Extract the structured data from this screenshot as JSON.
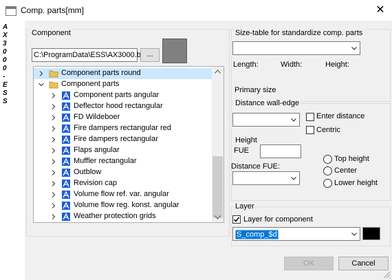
{
  "window": {
    "title": "Comp. parts[mm]",
    "close_symbol": "✕"
  },
  "side": {
    "text": "AX3000 - ESS"
  },
  "component": {
    "group_label": "Component",
    "path_value": "C:\\ProgramData\\ESS\\AX3000.b",
    "browse_label": "...",
    "tree": [
      {
        "label": "Component parts round",
        "icon": "folder-icon",
        "chevron": "right",
        "indent": 0,
        "selected": true
      },
      {
        "label": "Component parts",
        "icon": "folder-icon",
        "chevron": "down",
        "indent": 0,
        "selected": false
      },
      {
        "label": "Component parts angular",
        "icon": "part-icon",
        "chevron": "right",
        "indent": 1,
        "selected": false
      },
      {
        "label": "Deflector hood rectangular",
        "icon": "part-icon",
        "chevron": "right",
        "indent": 1,
        "selected": false
      },
      {
        "label": "FD Wildeboer",
        "icon": "part-icon",
        "chevron": "right",
        "indent": 1,
        "selected": false
      },
      {
        "label": "Fire dampers rectangular red",
        "icon": "part-icon",
        "chevron": "right",
        "indent": 1,
        "selected": false
      },
      {
        "label": "Fire dampers rectangular",
        "icon": "part-icon",
        "chevron": "right",
        "indent": 1,
        "selected": false
      },
      {
        "label": "Flaps angular",
        "icon": "part-icon",
        "chevron": "right",
        "indent": 1,
        "selected": false
      },
      {
        "label": "Muffler rectangular",
        "icon": "part-icon",
        "chevron": "right",
        "indent": 1,
        "selected": false
      },
      {
        "label": "Outblow",
        "icon": "part-icon",
        "chevron": "right",
        "indent": 1,
        "selected": false
      },
      {
        "label": "Revision cap",
        "icon": "part-icon",
        "chevron": "right",
        "indent": 1,
        "selected": false
      },
      {
        "label": "Volume flow ref.  var. angular",
        "icon": "part-icon",
        "chevron": "right",
        "indent": 1,
        "selected": false
      },
      {
        "label": "Volume flow reg. konst. angular",
        "icon": "part-icon",
        "chevron": "right",
        "indent": 1,
        "selected": false
      },
      {
        "label": "Weather protection grids",
        "icon": "part-icon",
        "chevron": "right",
        "indent": 1,
        "selected": false
      }
    ]
  },
  "size_table": {
    "group_label": "Size-table for standardize comp. parts",
    "combo_value": "",
    "length_label": "Length:",
    "width_label": "Width:",
    "height_label": "Height:",
    "primary_size_label": "Primary size"
  },
  "distance": {
    "group_label": "Distance wall-edge",
    "combo_value": "",
    "enter_distance_label": "Enter distance",
    "enter_distance_checked": false,
    "centric_label": "Centric",
    "centric_checked": false
  },
  "height": {
    "group_label": "Height",
    "fue_label": "FUE",
    "fue_value": "",
    "distance_fue_label": "Distance FUE:",
    "distance_fue_value": "",
    "radios": [
      {
        "label": "Top height",
        "checked": false
      },
      {
        "label": "Center",
        "checked": false
      },
      {
        "label": "Lower height",
        "checked": false
      }
    ]
  },
  "layer": {
    "group_label": "Layer",
    "checkbox_label": "Layer for component",
    "checked": true,
    "combo_value": "S_comp_$d",
    "color": "#000000"
  },
  "buttons": {
    "ok_label": "OK",
    "cancel_label": "Cancel"
  },
  "colors": {
    "selection": "#0078d7",
    "tree_highlight": "#cce8ff",
    "icon_blue": "#1e5fcf",
    "folder_yellow": "#e8c15a"
  }
}
